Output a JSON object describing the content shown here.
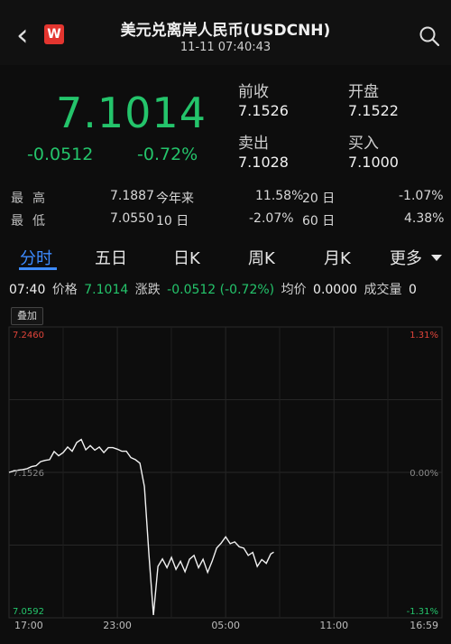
{
  "header": {
    "back_icon": "back-chevron-icon",
    "logo_icon": "wind-logo-icon",
    "logo_text": "W",
    "title": "美元兑离岸人民币(USDCNH)",
    "datetime": "11-11 07:40:43",
    "search_icon": "search-icon"
  },
  "quote": {
    "price": "7.1014",
    "change": "-0.0512",
    "change_pct": "-0.72%",
    "prev_close_label": "前收",
    "prev_close": "7.1526",
    "open_label": "开盘",
    "open": "7.1522",
    "ask_label": "卖出",
    "ask": "7.1028",
    "bid_label": "买入",
    "bid": "7.1000",
    "color_down": "#24c46b"
  },
  "stats": {
    "high_label": "最高",
    "high": "7.1887",
    "ytd_label": "今年来",
    "ytd": "11.58%",
    "d20_label": "20 日",
    "d20": "-1.07%",
    "low_label": "最低",
    "low": "7.0550",
    "d10_label": "10 日",
    "d10": "-2.07%",
    "d60_label": "60 日",
    "d60": "4.38%"
  },
  "tabs": [
    {
      "label": "分时",
      "active": true
    },
    {
      "label": "五日"
    },
    {
      "label": "日K"
    },
    {
      "label": "周K"
    },
    {
      "label": "月K"
    },
    {
      "label": "更多"
    }
  ],
  "ticker": {
    "time": "07:40",
    "price_label": "价格",
    "price": "7.1014",
    "chg_label": "涨跌",
    "chg": "-0.0512 (-0.72%)",
    "avg_label": "均价",
    "avg": "0.0000",
    "vol_label": "成交量",
    "vol": "0"
  },
  "overlay_label": "叠加",
  "chart_data": {
    "type": "line",
    "y_top_label": "7.2460",
    "y_mid_label": "7.1526",
    "y_bottom_label": "7.0592",
    "pct_top": "1.31%",
    "pct_mid": "0.00%",
    "pct_bottom": "-1.31%",
    "ylim": [
      7.0592,
      7.246
    ],
    "prev_close": 7.1526,
    "x_ticks": [
      "17:00",
      "23:00",
      "05:00",
      "11:00",
      "16:59"
    ],
    "x_start": "17:00",
    "x_end": "16:59",
    "series": [
      {
        "x": [
          "17:00",
          "17:15",
          "17:30",
          "17:45",
          "18:00",
          "18:15",
          "18:30",
          "18:45",
          "19:00",
          "19:15",
          "19:30",
          "19:45",
          "20:00",
          "20:15",
          "20:30",
          "20:45",
          "21:00",
          "21:15",
          "21:30",
          "21:45",
          "22:00",
          "22:15",
          "22:30",
          "22:45",
          "23:00",
          "23:15",
          "23:30",
          "23:45",
          "00:00",
          "00:15",
          "00:30",
          "00:45",
          "01:00",
          "01:15",
          "01:30",
          "01:45",
          "02:00",
          "02:15",
          "02:30",
          "02:45",
          "03:00",
          "03:15",
          "03:30",
          "03:45",
          "04:00",
          "04:15",
          "04:30",
          "04:45",
          "05:00",
          "05:15",
          "05:30",
          "05:45",
          "06:00",
          "06:15",
          "06:30",
          "06:45",
          "07:00",
          "07:15",
          "07:30",
          "07:40"
        ],
        "y": [
          7.1526,
          7.1535,
          7.154,
          7.1544,
          7.155,
          7.1563,
          7.1569,
          7.1595,
          7.1603,
          7.1608,
          7.166,
          7.1633,
          7.1653,
          7.1689,
          7.1662,
          7.1718,
          7.1738,
          7.1671,
          7.1698,
          7.1669,
          7.1689,
          7.1653,
          7.1685,
          7.1685,
          7.1675,
          7.1662,
          7.1662,
          7.1621,
          7.1608,
          7.1585,
          7.1435,
          7.1,
          7.061,
          7.0922,
          7.097,
          7.0914,
          7.098,
          7.0903,
          7.0955,
          7.0888,
          7.0968,
          7.0993,
          7.0914,
          7.0968,
          7.0884,
          7.0956,
          7.104,
          7.1072,
          7.1112,
          7.1068,
          7.108,
          7.1048,
          7.104,
          7.0993,
          7.1012,
          7.0922,
          7.0966,
          7.0942,
          7.1002,
          7.1014
        ]
      }
    ]
  }
}
